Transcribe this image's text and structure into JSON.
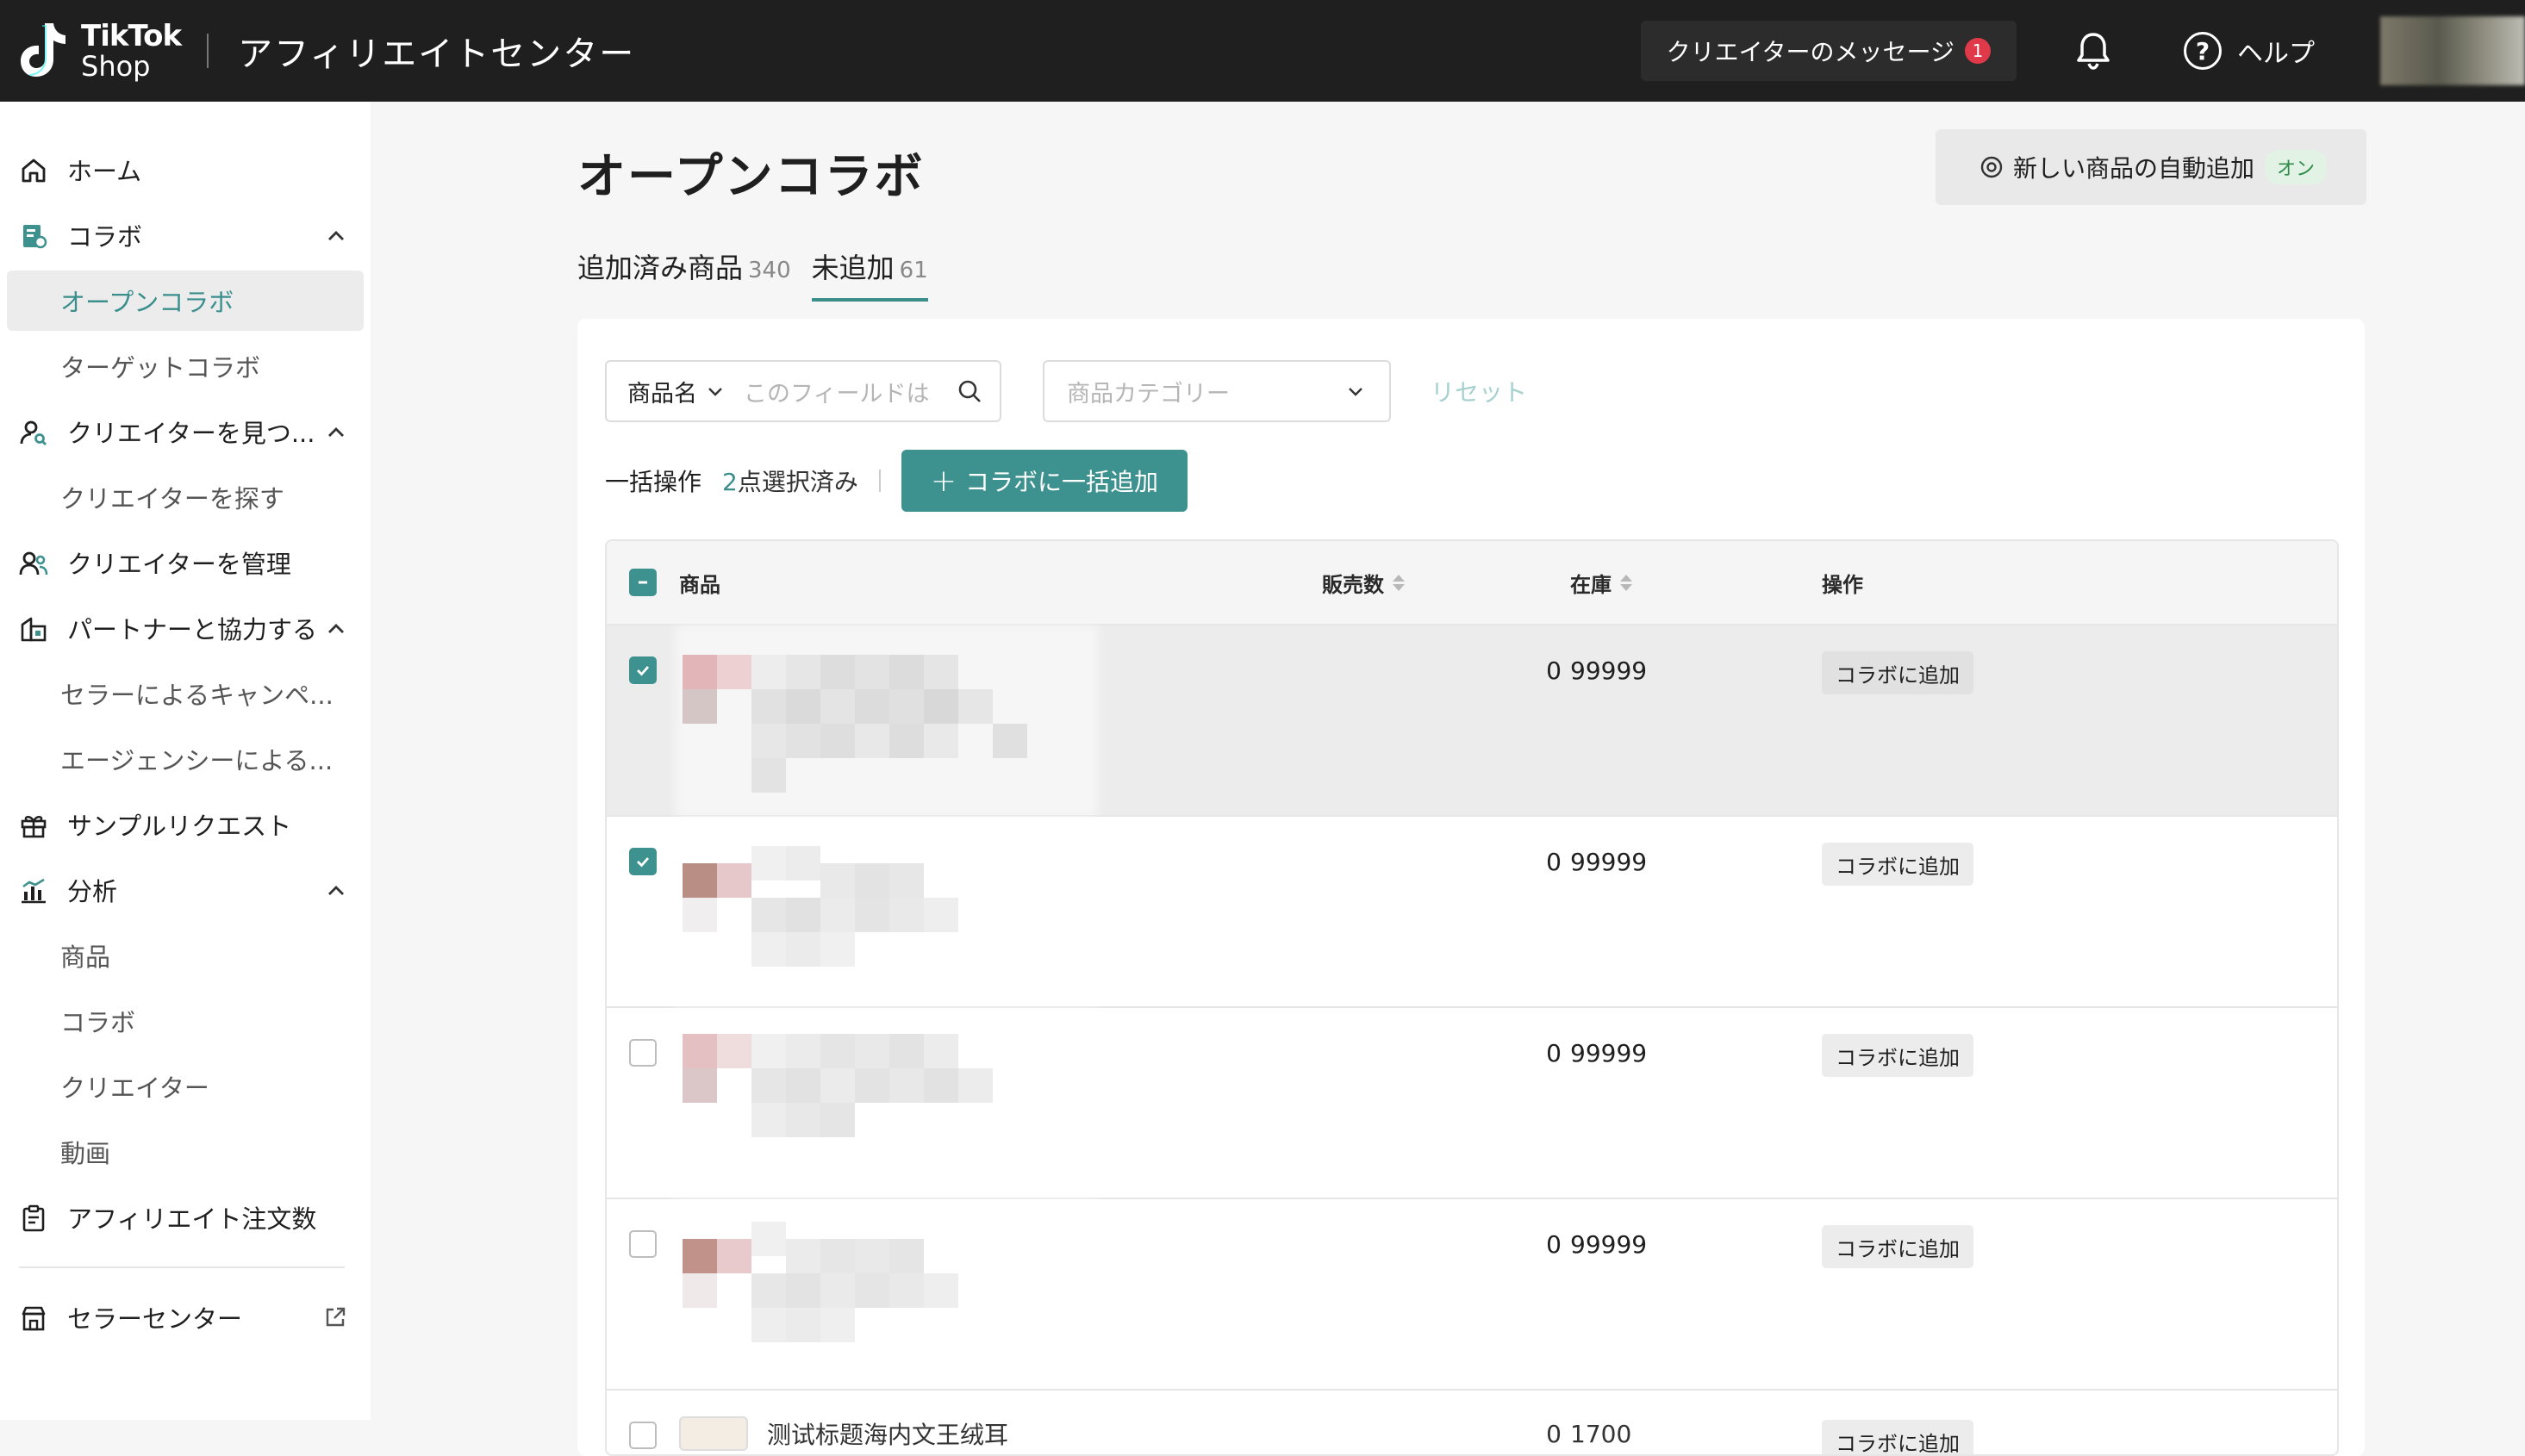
{
  "app": {
    "logo_line1": "TikTok",
    "logo_line2": "Shop",
    "title": "アフィリエイトセンター"
  },
  "topbar": {
    "messages_label": "クリエイターのメッセージ",
    "messages_badge": "1",
    "help_label": "ヘルプ",
    "icons": [
      "bell-icon",
      "help-icon"
    ]
  },
  "sidebar": {
    "items": [
      {
        "label": "ホーム",
        "icon": "home-icon"
      },
      {
        "label": "コラボ",
        "icon": "collab-icon"
      },
      {
        "label": "オープンコラボ",
        "active": true
      },
      {
        "label": "ターゲットコラボ"
      },
      {
        "label": "クリエイターを見つ...",
        "icon": "find-creator-icon"
      },
      {
        "label": "クリエイターを探す"
      },
      {
        "label": "クリエイターを管理",
        "icon": "manage-creator-icon"
      },
      {
        "label": "パートナーと協力する",
        "icon": "partner-icon"
      },
      {
        "label": "セラーによるキャンペ..."
      },
      {
        "label": "エージェンシーによる..."
      },
      {
        "label": "サンプルリクエスト",
        "icon": "gift-icon"
      },
      {
        "label": "分析",
        "icon": "analytics-icon"
      },
      {
        "label": "商品"
      },
      {
        "label": "コラボ"
      },
      {
        "label": "クリエイター"
      },
      {
        "label": "動画"
      },
      {
        "label": "アフィリエイト注文数",
        "icon": "clipboard-icon"
      },
      {
        "label": "セラーセンター",
        "icon": "store-icon"
      }
    ]
  },
  "page": {
    "title": "オープンコラボ",
    "auto_add_label": "新しい商品の自動追加",
    "auto_add_state": "オン"
  },
  "tabs": [
    {
      "label": "追加済み商品",
      "count": "340"
    },
    {
      "label": "未追加",
      "count": "61",
      "active": true
    }
  ],
  "filters": {
    "name_select": "商品名",
    "name_placeholder": "このフィールドは",
    "category_placeholder": "商品カテゴリー",
    "reset": "リセット"
  },
  "bulk": {
    "label": "一括操作",
    "selected_count": "2",
    "selected_suffix": "点選択済み",
    "button": "コラボに一括追加"
  },
  "table": {
    "headers": {
      "product": "商品",
      "sales": "販売数",
      "stock": "在庫",
      "action": "操作"
    },
    "rows": [
      {
        "checked": true,
        "sales": "0",
        "stock": "99999",
        "action": "コラボに追加",
        "highlighted": true
      },
      {
        "checked": true,
        "sales": "0",
        "stock": "99999",
        "action": "コラボに追加"
      },
      {
        "checked": false,
        "sales": "0",
        "stock": "99999",
        "action": "コラボに追加"
      },
      {
        "checked": false,
        "sales": "0",
        "stock": "99999",
        "action": "コラボに追加"
      }
    ],
    "partial_row": {
      "title": "测试标题海内文王绒耳",
      "sales": "0",
      "stock": "1700",
      "action": "コラボに追加"
    }
  },
  "colors": {
    "accent": "#3d918e",
    "topbar": "#1f1f1f",
    "badge": "#e0394a"
  }
}
